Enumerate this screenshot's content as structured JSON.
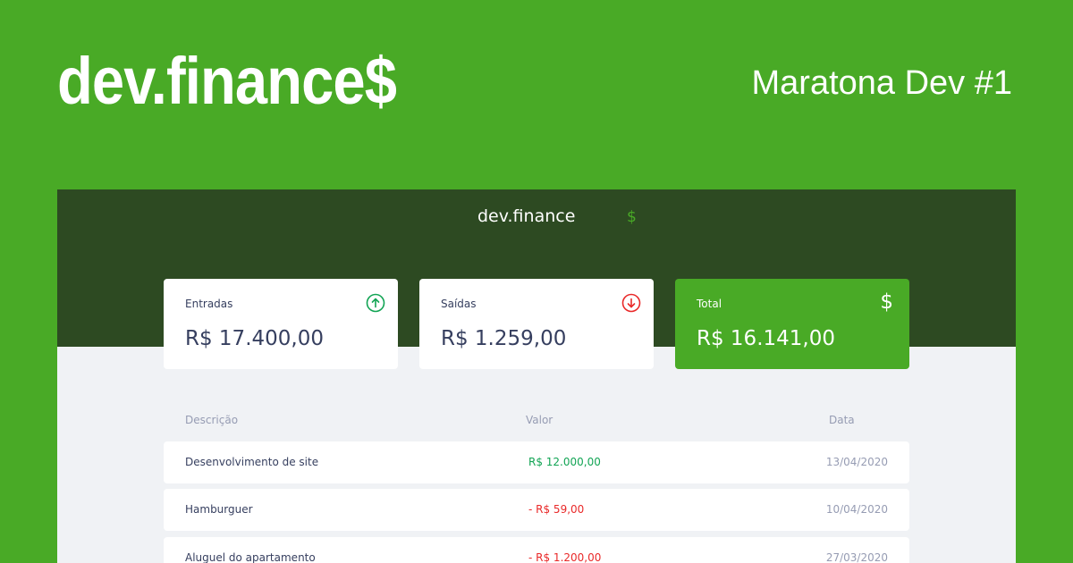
{
  "banner": {
    "logo": "dev.finance$",
    "tagline": "Maratona Dev #1"
  },
  "app": {
    "logo_text": "dev.finance",
    "logo_dollar": "$"
  },
  "cards": {
    "income": {
      "label": "Entradas",
      "value": "R$ 17.400,00",
      "icon": "arrow-up-circle-icon",
      "icon_color": "#12a454"
    },
    "expense": {
      "label": "Saídas",
      "value": "R$ 1.259,00",
      "icon": "arrow-down-circle-icon",
      "icon_color": "#e92929"
    },
    "total": {
      "label": "Total",
      "value": "R$ 16.141,00",
      "icon": "dollar-sign-icon",
      "icon_glyph": "$"
    }
  },
  "table": {
    "headers": {
      "description": "Descrição",
      "amount": "Valor",
      "date": "Data"
    },
    "rows": [
      {
        "description": "Desenvolvimento de site",
        "amount": "R$ 12.000,00",
        "date": "13/04/2020",
        "type": "income"
      },
      {
        "description": "Hamburguer",
        "amount": "- R$ 59,00",
        "date": "10/04/2020",
        "type": "expense"
      },
      {
        "description": "Aluguel do apartamento",
        "amount": "- R$ 1.200,00",
        "date": "27/03/2020",
        "type": "expense"
      }
    ]
  },
  "colors": {
    "brand_green": "#49aa26",
    "header_dark_green": "#2d4a22",
    "background": "#f0f2f5",
    "text_primary": "#363f5f",
    "text_muted": "#969cb3",
    "income": "#12a454",
    "expense": "#e92929"
  }
}
